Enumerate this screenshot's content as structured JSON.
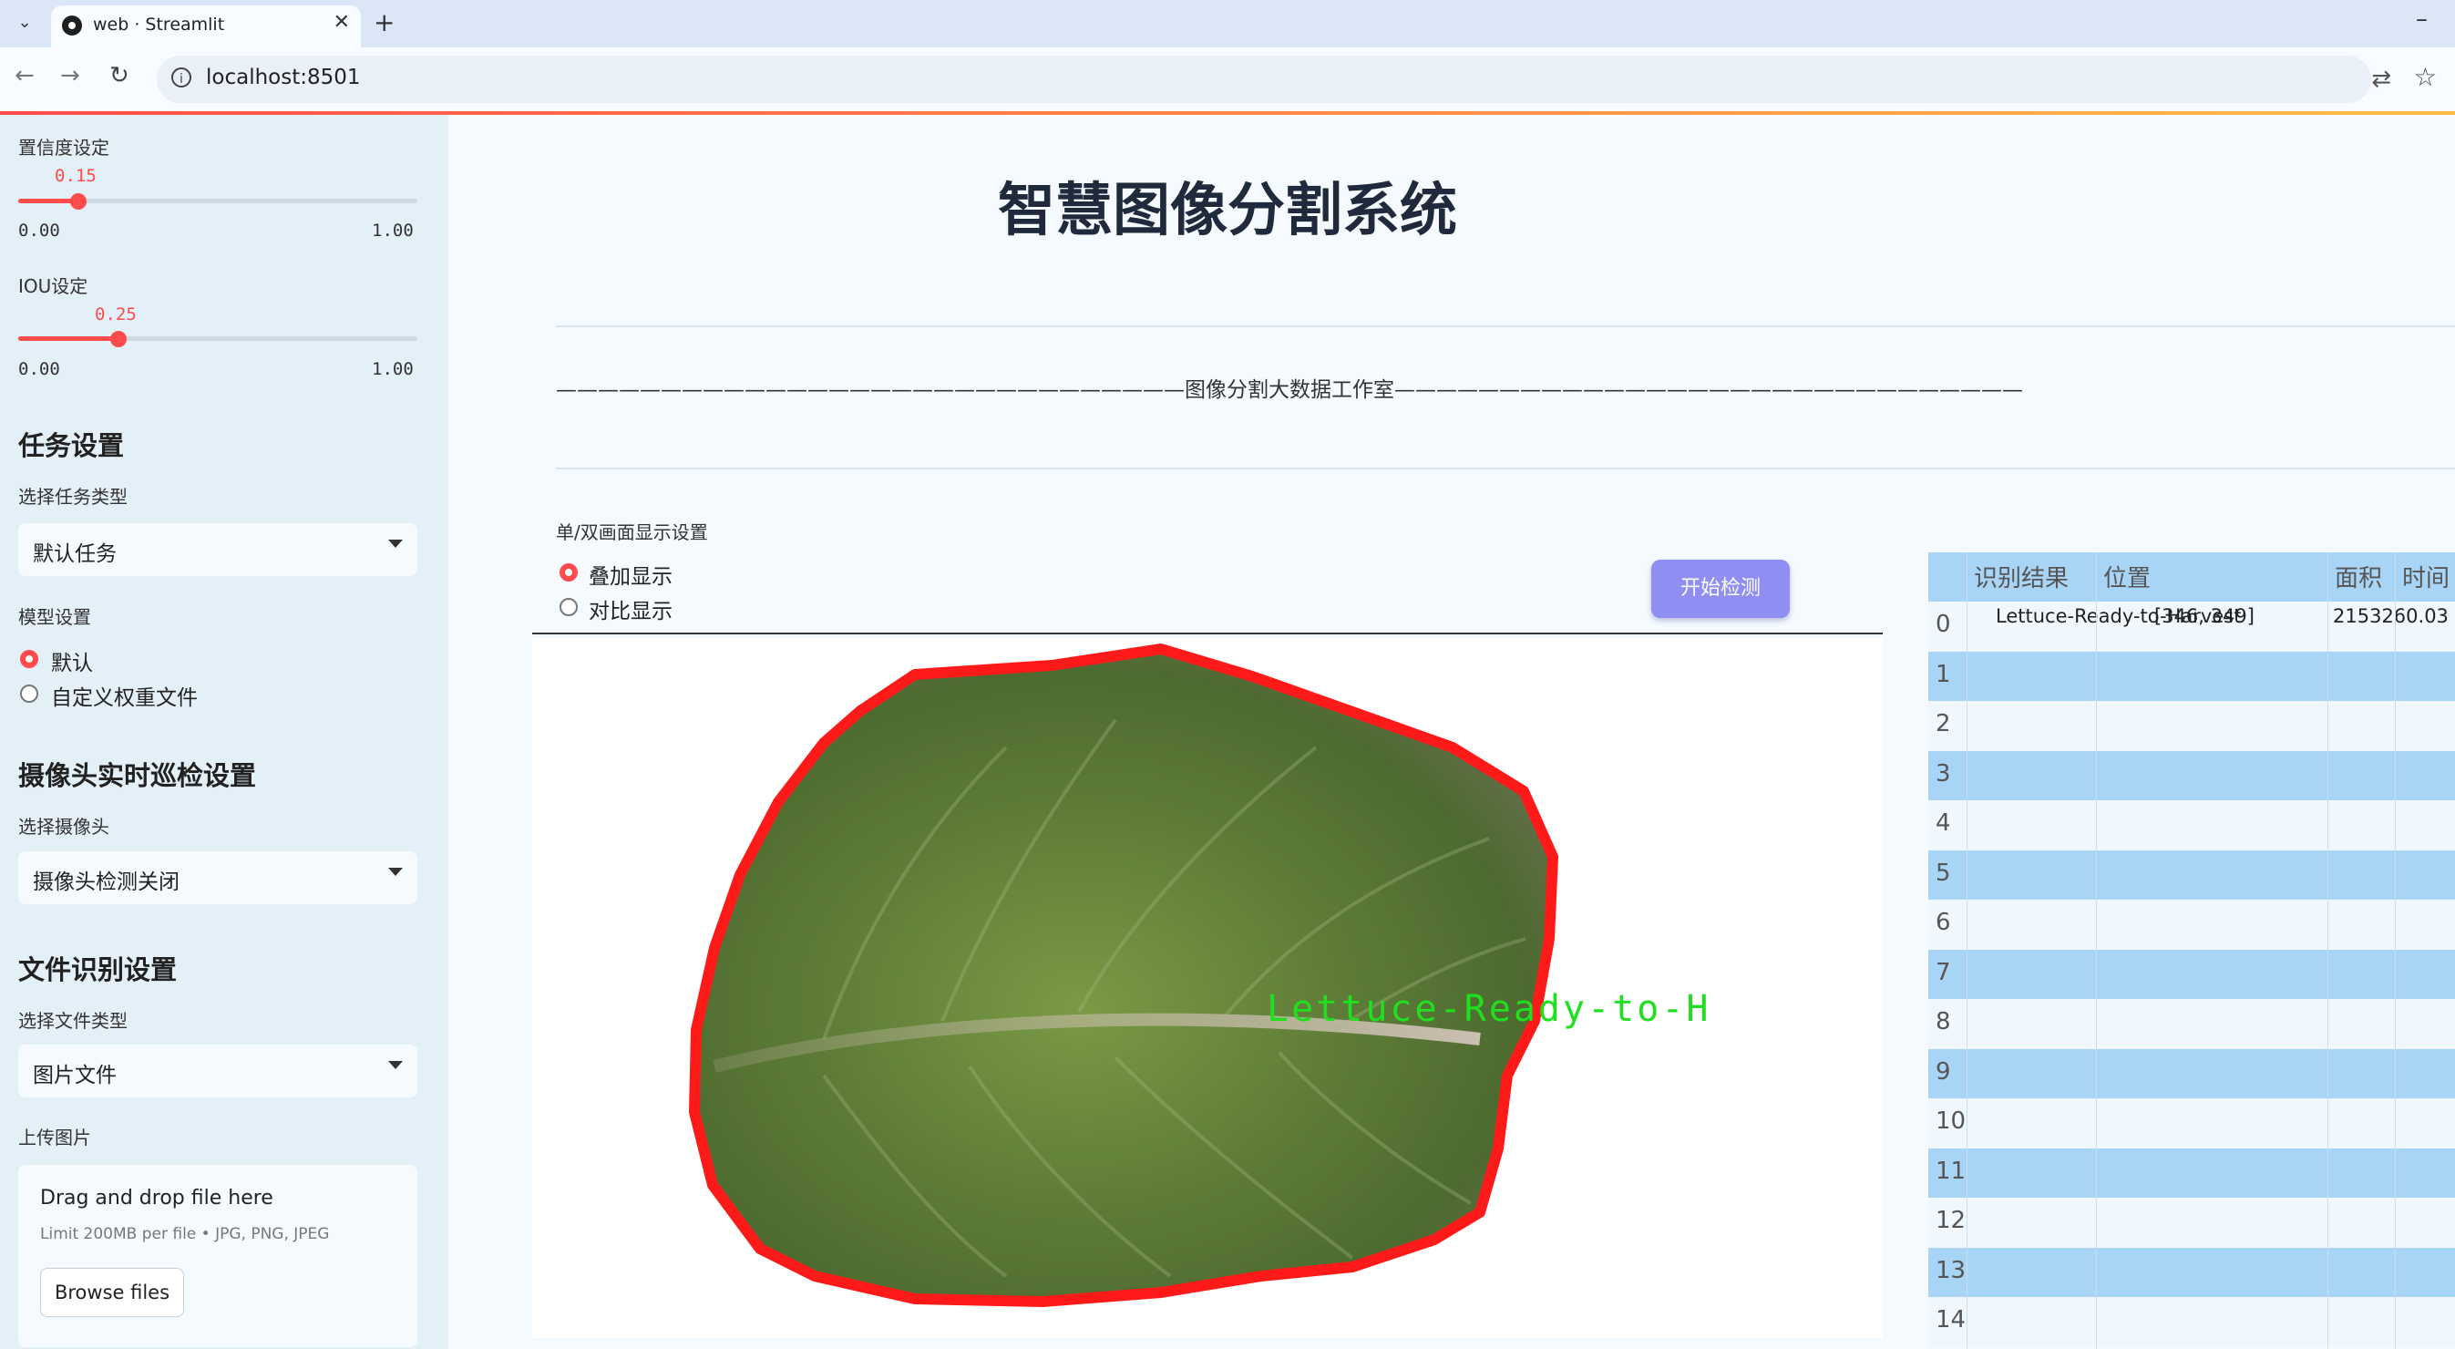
{
  "browser": {
    "tab_title": "web · Streamlit",
    "tab_close": "✕",
    "new_tab": "+",
    "url": "localhost:8501"
  },
  "sidebar": {
    "confidence": {
      "label": "置信度设定",
      "value": "0.15",
      "min": "0.00",
      "max": "1.00",
      "fraction": 0.15
    },
    "iou": {
      "label": "IOU设定",
      "value": "0.25",
      "min": "0.00",
      "max": "1.00",
      "fraction": 0.25
    },
    "task_section": {
      "title": "任务设置",
      "select_label": "选择任务类型",
      "selected": "默认任务"
    },
    "model_section": {
      "label": "模型设置",
      "options": [
        "默认",
        "自定义权重文件"
      ],
      "selected_index": 0
    },
    "camera_section": {
      "title": "摄像头实时巡检设置",
      "select_label": "选择摄像头",
      "selected": "摄像头检测关闭"
    },
    "file_section": {
      "title": "文件识别设置",
      "select_label": "选择文件类型",
      "selected": "图片文件"
    },
    "upload": {
      "label": "上传图片",
      "drop_text": "Drag and drop file here",
      "limit_text": "Limit 200MB per file • JPG, PNG, JPEG",
      "browse_label": "Browse files"
    }
  },
  "main": {
    "title": "智慧图像分割系统",
    "banner": "——————————————————————————————图像分割大数据工作室——————————————————————————————",
    "display_label": "单/双画面显示设置",
    "display_options": [
      "叠加显示",
      "对比显示"
    ],
    "display_selected": 0,
    "detect_button": "开始检测",
    "overlay_label": "Lettuce-Ready-to-H"
  },
  "results_table": {
    "columns": [
      "识别结果",
      "位置",
      "面积",
      "时间"
    ],
    "rows": [
      {
        "index": "0",
        "result": "Lettuce-Ready-to-Harvest",
        "position": "[346, 349]",
        "area": "2153260.03"
      },
      {
        "index": "1"
      },
      {
        "index": "2"
      },
      {
        "index": "3"
      },
      {
        "index": "4"
      },
      {
        "index": "5"
      },
      {
        "index": "6"
      },
      {
        "index": "7"
      },
      {
        "index": "8"
      },
      {
        "index": "9"
      },
      {
        "index": "10"
      },
      {
        "index": "11"
      },
      {
        "index": "12"
      },
      {
        "index": "13"
      },
      {
        "index": "14"
      }
    ]
  },
  "colors": {
    "accent": "#ff4b4b",
    "sidebar_bg": "#e3f0f8",
    "table_stripe": "#a8d4f5",
    "button": "#8f8ff3",
    "mask_outline": "#ff1a1a",
    "overlay_text": "#1fe01f"
  }
}
